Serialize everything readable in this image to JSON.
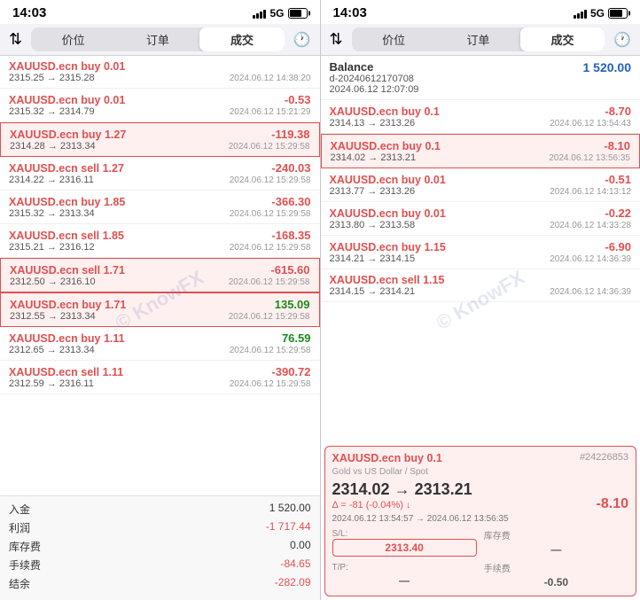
{
  "left": {
    "statusBar": {
      "time": "14:03",
      "signal": "5G"
    },
    "tabs": [
      "价位",
      "订单",
      "成交"
    ],
    "activeTab": "成交",
    "trades": [
      {
        "symbol": "XAUUSD.ecn",
        "action": "buy",
        "size": "0.01",
        "from": "2315.25",
        "to": "2315.28",
        "datetime": "2024.06.12 14:38:20",
        "profit": "",
        "profitSign": ""
      },
      {
        "symbol": "XAUUSD.ecn",
        "action": "buy",
        "size": "0.01",
        "from": "2315.32",
        "to": "2314.79",
        "datetime": "2024.06.12 15:21:29",
        "profit": "-0.53",
        "profitSign": "neg",
        "highlighted": false
      },
      {
        "symbol": "XAUUSD.ecn",
        "action": "buy",
        "size": "1.27",
        "from": "2314.28",
        "to": "2313.34",
        "datetime": "2024.06.12 15:29:58",
        "profit": "-119.38",
        "profitSign": "neg",
        "highlighted": true
      },
      {
        "symbol": "XAUUSD.ecn",
        "action": "sell",
        "size": "1.27",
        "from": "2314.22",
        "to": "2316.11",
        "datetime": "2024.06.12 15:29:58",
        "profit": "-240.03",
        "profitSign": "neg",
        "highlighted": false
      },
      {
        "symbol": "XAUUSD.ecn",
        "action": "buy",
        "size": "1.85",
        "from": "2315.32",
        "to": "2313.34",
        "datetime": "2024.06.12 15:29:58",
        "profit": "-366.30",
        "profitSign": "neg",
        "highlighted": false
      },
      {
        "symbol": "XAUUSD.ecn",
        "action": "sell",
        "size": "1.85",
        "from": "2315.21",
        "to": "2316.12",
        "datetime": "2024.06.12 15:29:58",
        "profit": "-168.35",
        "profitSign": "neg",
        "highlighted": false
      },
      {
        "symbol": "XAUUSD.ecn",
        "action": "sell",
        "size": "1.71",
        "from": "2312.50",
        "to": "2316.10",
        "datetime": "2024.06.12 15:29:58",
        "profit": "-615.60",
        "profitSign": "neg",
        "highlighted": true
      },
      {
        "symbol": "XAUUSD.ecn",
        "action": "buy",
        "size": "1.71",
        "from": "2312.55",
        "to": "2313.34",
        "datetime": "2024.06.12 15:29:58",
        "profit": "135.09",
        "profitSign": "pos",
        "highlighted": true
      },
      {
        "symbol": "XAUUSD.ecn",
        "action": "buy",
        "size": "1.11",
        "from": "2312.65",
        "to": "2313.34",
        "datetime": "2024.06.12 15:29:58",
        "profit": "76.59",
        "profitSign": "pos",
        "highlighted": false
      },
      {
        "symbol": "XAUUSD.ecn",
        "action": "sell",
        "size": "1.11",
        "from": "2312.59",
        "to": "2316.11",
        "datetime": "2024.06.12 15:29:58",
        "profit": "-390.72",
        "profitSign": "neg",
        "highlighted": false
      }
    ],
    "summary": [
      {
        "label": "入金",
        "value": "1 520.00",
        "class": ""
      },
      {
        "label": "利润",
        "value": "-1 717.44",
        "class": "neg"
      },
      {
        "label": "库存费",
        "value": "0.00",
        "class": ""
      },
      {
        "label": "手续费",
        "value": "-84.65",
        "class": "neg"
      },
      {
        "label": "结余",
        "value": "-282.09",
        "class": "neg"
      }
    ],
    "watermark": "© KnowFX"
  },
  "right": {
    "statusBar": {
      "time": "14:03",
      "signal": "5G"
    },
    "tabs": [
      "价位",
      "订单",
      "成交"
    ],
    "activeTab": "成交",
    "balance": {
      "label": "Balance",
      "accountId": "d-20240612170708",
      "datetime": "2024.06.12 12:07:09",
      "value": "1 520.00"
    },
    "trades": [
      {
        "symbol": "XAUUSD.ecn",
        "action": "buy",
        "size": "0.1",
        "from": "2314.13",
        "to": "2313.26",
        "datetime": "2024.06.12 13:54:43",
        "profit": "-8.70",
        "profitSign": "neg"
      },
      {
        "symbol": "XAUUSD.ecn",
        "action": "buy",
        "size": "0.1",
        "from": "2314.02",
        "to": "2313.21",
        "datetime": "2024.06.12 13:56:35",
        "profit": "-8.10",
        "profitSign": "neg",
        "highlighted": true
      },
      {
        "symbol": "XAUUSD.ecn",
        "action": "buy",
        "size": "0.01",
        "from": "2313.77",
        "to": "2313.26",
        "datetime": "2024.06.12 14:13:12",
        "profit": "-0.51",
        "profitSign": "neg"
      },
      {
        "symbol": "XAUUSD.ecn",
        "action": "buy",
        "size": "0.01",
        "from": "2313.80",
        "to": "2313.58",
        "datetime": "2024.06.12 14:33:28",
        "profit": "-0.22",
        "profitSign": "neg"
      },
      {
        "symbol": "XAUUSD.ecn",
        "action": "buy",
        "size": "1.15",
        "from": "2314.21",
        "to": "2314.15",
        "datetime": "2024.06.12 14:36:39",
        "profit": "-6.90",
        "profitSign": "neg"
      },
      {
        "symbol": "XAUUSD.ecn",
        "action": "sell",
        "size": "1.15",
        "from": "2314.15",
        "to": "2314.21",
        "datetime": "2024.06.12 14:36:39",
        "profit": "",
        "profitSign": ""
      }
    ],
    "detail": {
      "symbol": "XAUUSD.ecn",
      "action": "buy",
      "size": "0.1",
      "orderId": "#24226853",
      "subtitle": "Gold vs US Dollar / Spot",
      "fromPrice": "2314.02",
      "toPrice": "2313.21",
      "delta": "Δ = -81 (-0.04%) ↓",
      "dateFrom": "2024.06.12 13:54:57",
      "dateTo": "2024.06.12 13:56:35",
      "sl": "2313.40",
      "tp": "—",
      "storage": "—",
      "commission": "-0.50",
      "profit": "-8.10"
    },
    "watermark": "© KnowFX"
  }
}
